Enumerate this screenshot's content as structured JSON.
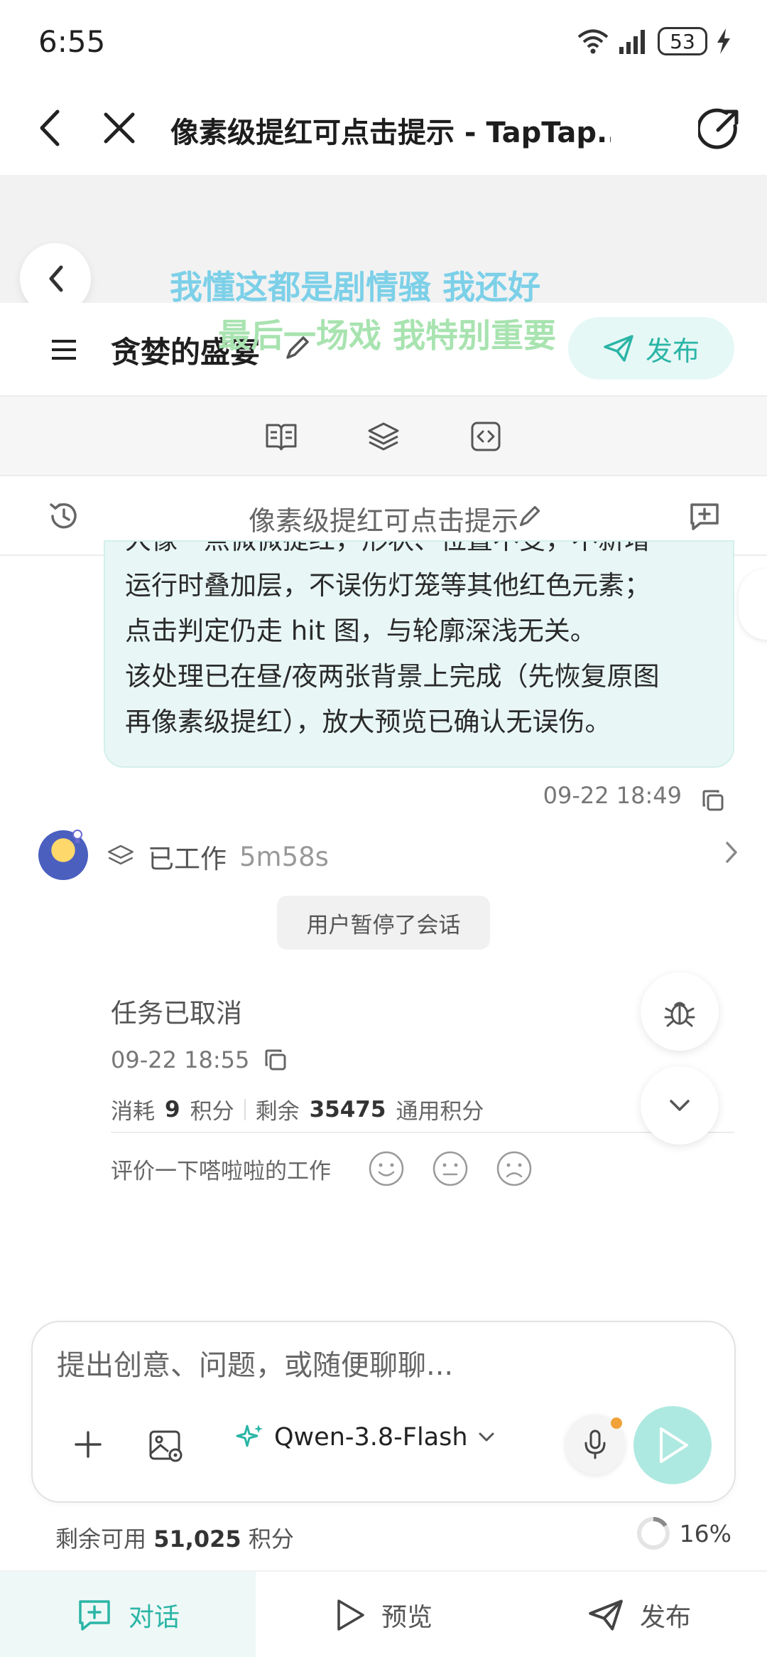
{
  "status_bar": {
    "time": "6:55",
    "battery": "53"
  },
  "browser": {
    "title": "像素级提红可点击提示 - TapTap..."
  },
  "lyrics": {
    "line1": "我懂这都是剧情骚 我还好",
    "line2": "最后一场戏 我特别重要"
  },
  "app_header": {
    "title": "贪婪的盛宴",
    "publish_label": "发布"
  },
  "session": {
    "title": "像素级提红可点击提示"
  },
  "message": {
    "lines": [
      "大像一点微微提红，形状、位置不变，不新增",
      "运行时叠加层，不误伤灯笼等其他红色元素；",
      "点击判定仍走 hit 图，与轮廓深浅无关。",
      "该处理已在昼/夜两张背景上完成（先恢复原图",
      "再像素级提红），放大预览已确认无误伤。"
    ],
    "time": "09-22 18:49"
  },
  "work": {
    "label": "已工作",
    "duration": "5m58s"
  },
  "pause_notice": "用户暂停了会话",
  "task": {
    "status": "任务已取消",
    "time": "09-22 18:55",
    "consumed_prefix": "消耗",
    "consumed_value": "9",
    "consumed_unit": "积分",
    "remaining_prefix": "剩余",
    "remaining_value": "35475",
    "remaining_unit": "通用积分",
    "rate_prompt": "评价一下嗒啦啦的工作"
  },
  "composer": {
    "placeholder": "提出创意、问题，或随便聊聊...",
    "model": "Qwen-3.8-Flash"
  },
  "credits": {
    "prefix": "剩余可用",
    "value": "51,025",
    "unit": "积分",
    "percent": "16%",
    "progress_fraction": 0.16
  },
  "nav": {
    "chat": "对话",
    "preview": "预览",
    "publish": "发布"
  },
  "colors": {
    "accent": "#2bb5a6",
    "bubble": "#e8f7f5",
    "send": "#aee9e1"
  }
}
